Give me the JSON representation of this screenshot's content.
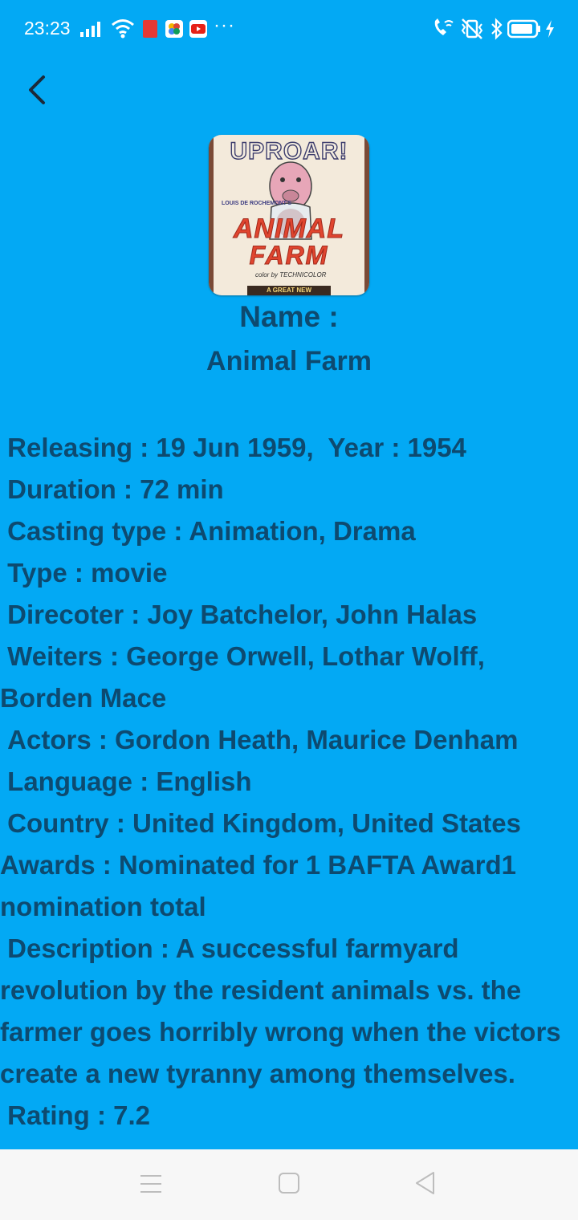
{
  "status_bar": {
    "time": "23:23",
    "more": "···"
  },
  "movie": {
    "poster": {
      "title": "UPROAR!",
      "presenter": "LOUIS DE ROCHEMONT'S",
      "line1": "ANIMAL",
      "line2": "FARM",
      "color": "color by TECHNICOLOR",
      "banner": "A GREAT NEW"
    },
    "name_label": "Name :",
    "name": "Animal Farm",
    "details": {
      "releasing": " Releasing : 19 Jun 1959,  Year : 1954",
      "duration": " Duration : 72 min",
      "casting_type": " Casting type : Animation, Drama",
      "type": " Type : movie",
      "director": " Direcoter : Joy Batchelor, John Halas",
      "writers": " Weiters : George Orwell, Lothar Wolff, Borden Mace",
      "actors": " Actors : Gordon Heath, Maurice Denham",
      "language": " Language : English",
      "country": " Country : United Kingdom, United States",
      "awards": "Awards : Nominated for 1 BAFTA Award1 nomination total",
      "description": " Description : A successful farmyard revolution by the resident animals vs. the farmer goes horribly wrong when the victors create a new tyranny among themselves.",
      "rating": " Rating : 7.2"
    }
  },
  "icons": {
    "back": "chevron-left",
    "nav_menu": "menu-lines",
    "nav_home": "square",
    "nav_back": "triangle-left"
  },
  "colors": {
    "background": "#03A9F4",
    "text": "#0D4A70",
    "nav_bar": "#F7F7F7"
  }
}
